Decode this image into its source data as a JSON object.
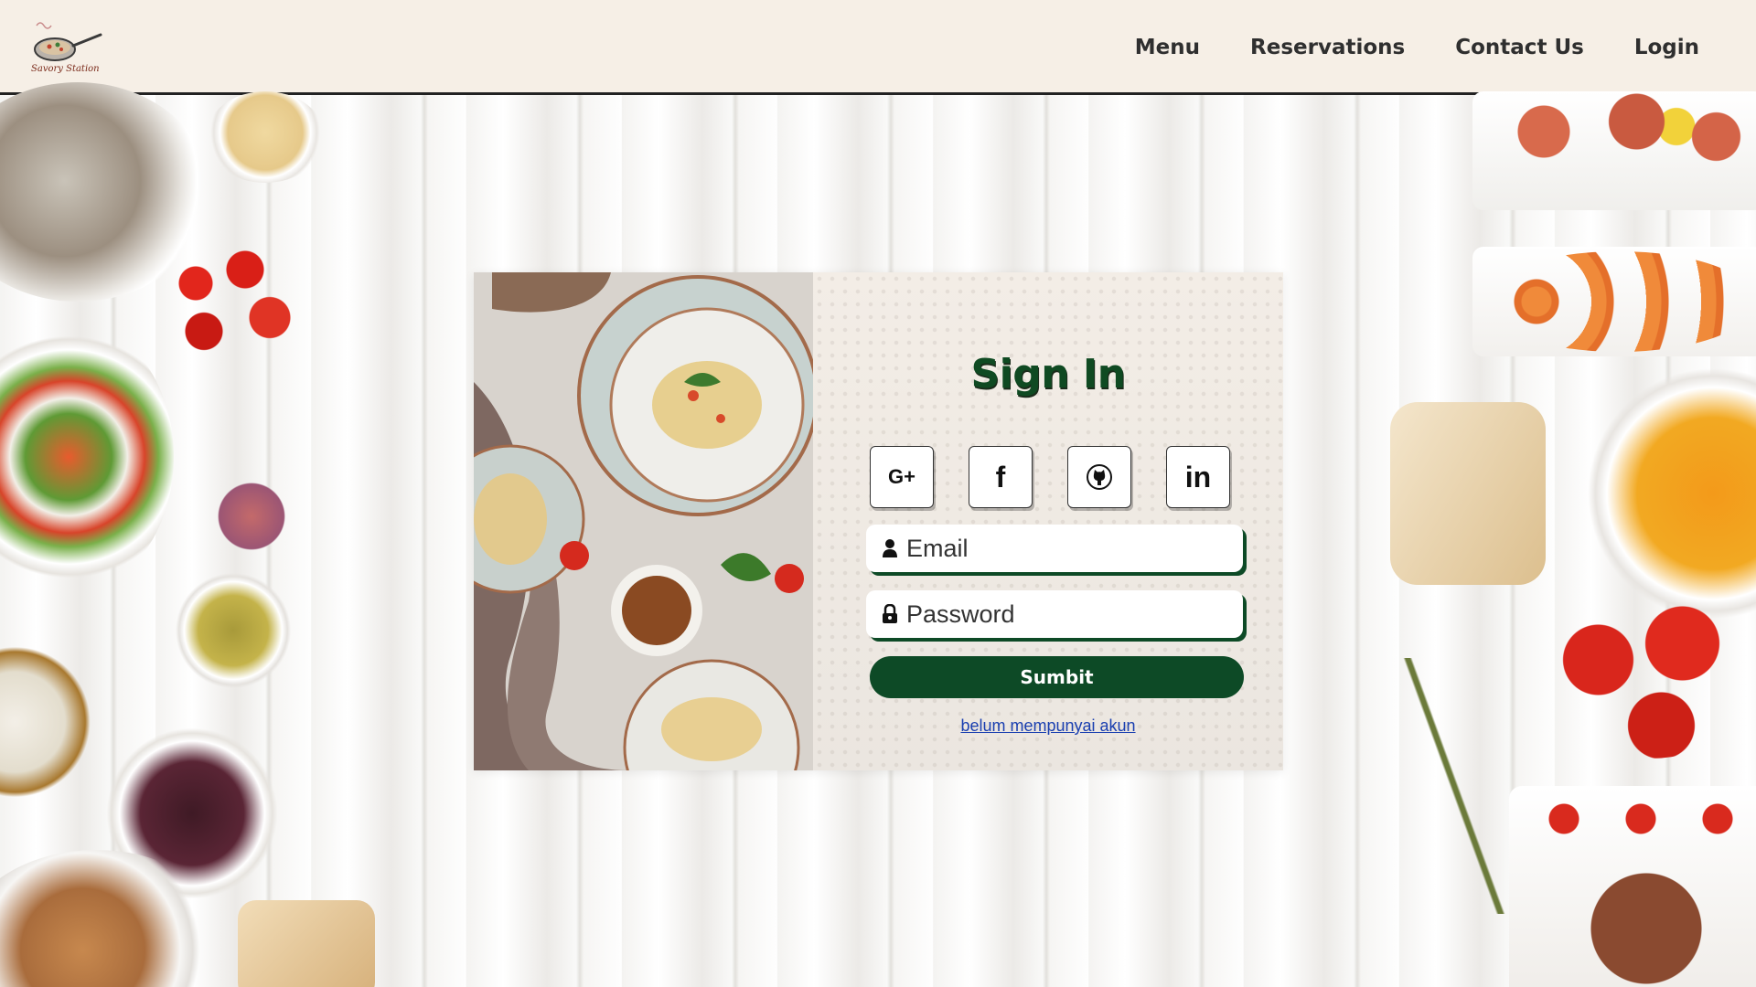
{
  "brand": {
    "logo_text": "Savory Station"
  },
  "nav": {
    "items": [
      {
        "label": "Menu"
      },
      {
        "label": "Reservations"
      },
      {
        "label": "Contact Us"
      },
      {
        "label": "Login"
      }
    ]
  },
  "signin": {
    "title": "Sign In",
    "socials": [
      {
        "label": "G+",
        "icon": "google-plus-icon"
      },
      {
        "label": "f",
        "icon": "facebook-icon"
      },
      {
        "label": "",
        "icon": "github-icon"
      },
      {
        "label": "in",
        "icon": "linkedin-icon"
      }
    ],
    "email_placeholder": "Email",
    "password_placeholder": "Password",
    "submit_label": "Sumbit",
    "register_link": "belum mempunyai akun"
  },
  "colors": {
    "accent": "#0d4a26",
    "header_bg": "#f6efe6",
    "link": "#1a3fb0"
  }
}
